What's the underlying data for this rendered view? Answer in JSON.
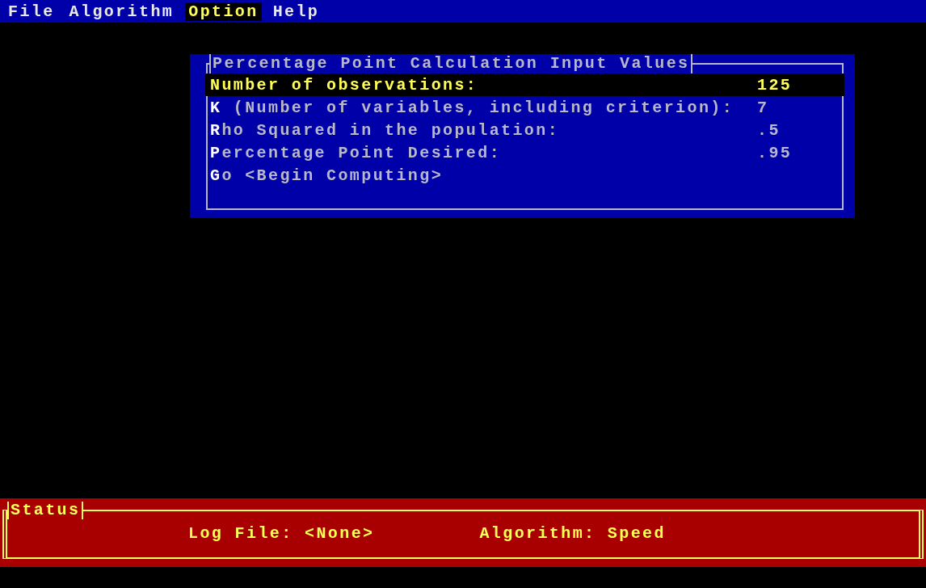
{
  "menu": [
    {
      "label": "File",
      "selected": false
    },
    {
      "label": "Algorithm",
      "selected": false
    },
    {
      "label": "Option",
      "selected": true
    },
    {
      "label": "Help",
      "selected": false
    }
  ],
  "dialog": {
    "title": "Percentage Point Calculation Input Values",
    "fields": [
      {
        "kind": "field",
        "label": "**N**umber of observations:",
        "value": "125",
        "selected": true
      },
      {
        "kind": "field",
        "label": "**K** (Number of variables, including criterion):",
        "value": "7",
        "selected": false
      },
      {
        "kind": "field",
        "label": "**R**ho Squared in the population:",
        "value": ".5",
        "selected": false
      },
      {
        "kind": "field",
        "label": "**P**ercentage Point Desired:",
        "value": ".95",
        "selected": false
      },
      {
        "kind": "action",
        "label": "**G**o <Begin Computing>",
        "selected": false
      }
    ]
  },
  "status_bar": {
    "title": "Status",
    "log_file": "Log File: <None>",
    "algorithm": "Algorithm: Speed"
  }
}
